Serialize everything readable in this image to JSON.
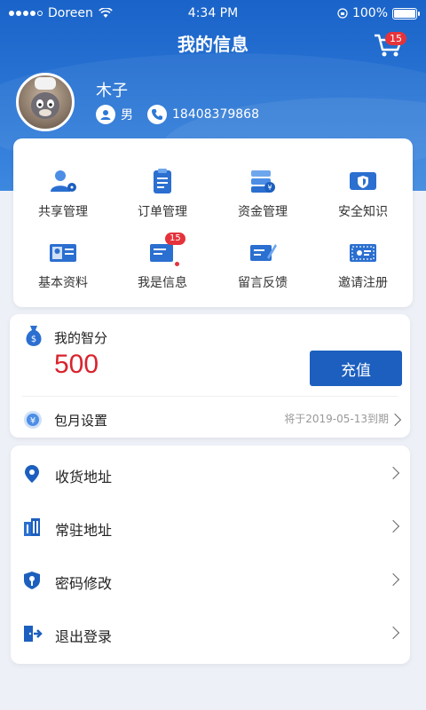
{
  "status_bar": {
    "carrier": "Doreen",
    "time": "4:34 PM",
    "battery": "100%"
  },
  "header": {
    "title": "我的信息",
    "cart_badge": "15"
  },
  "profile": {
    "name": "木子",
    "gender": "男",
    "phone": "18408379868"
  },
  "grid": [
    {
      "label": "共享管理",
      "icon": "share-management-icon"
    },
    {
      "label": "订单管理",
      "icon": "order-management-icon"
    },
    {
      "label": "资金管理",
      "icon": "fund-management-icon"
    },
    {
      "label": "安全知识",
      "icon": "security-knowledge-icon"
    },
    {
      "label": "基本资料",
      "icon": "profile-card-icon"
    },
    {
      "label": "我是信息",
      "icon": "messages-icon",
      "badge": "15"
    },
    {
      "label": "留言反馈",
      "icon": "feedback-icon"
    },
    {
      "label": "邀请注册",
      "icon": "invite-register-icon"
    }
  ],
  "points": {
    "title": "我的智分",
    "value": "500",
    "recharge_label": "充值",
    "monthly_label": "包月设置",
    "expire_text": "将于2019-05-13到期"
  },
  "menu": [
    {
      "label": "收货地址",
      "icon": "location-pin-icon"
    },
    {
      "label": "常驻地址",
      "icon": "building-icon"
    },
    {
      "label": "密码修改",
      "icon": "password-key-icon"
    },
    {
      "label": "退出登录",
      "icon": "logout-icon"
    }
  ],
  "colors": {
    "primary": "#1c5fbe",
    "accent_red": "#d9232d",
    "badge_red": "#e5333b"
  }
}
